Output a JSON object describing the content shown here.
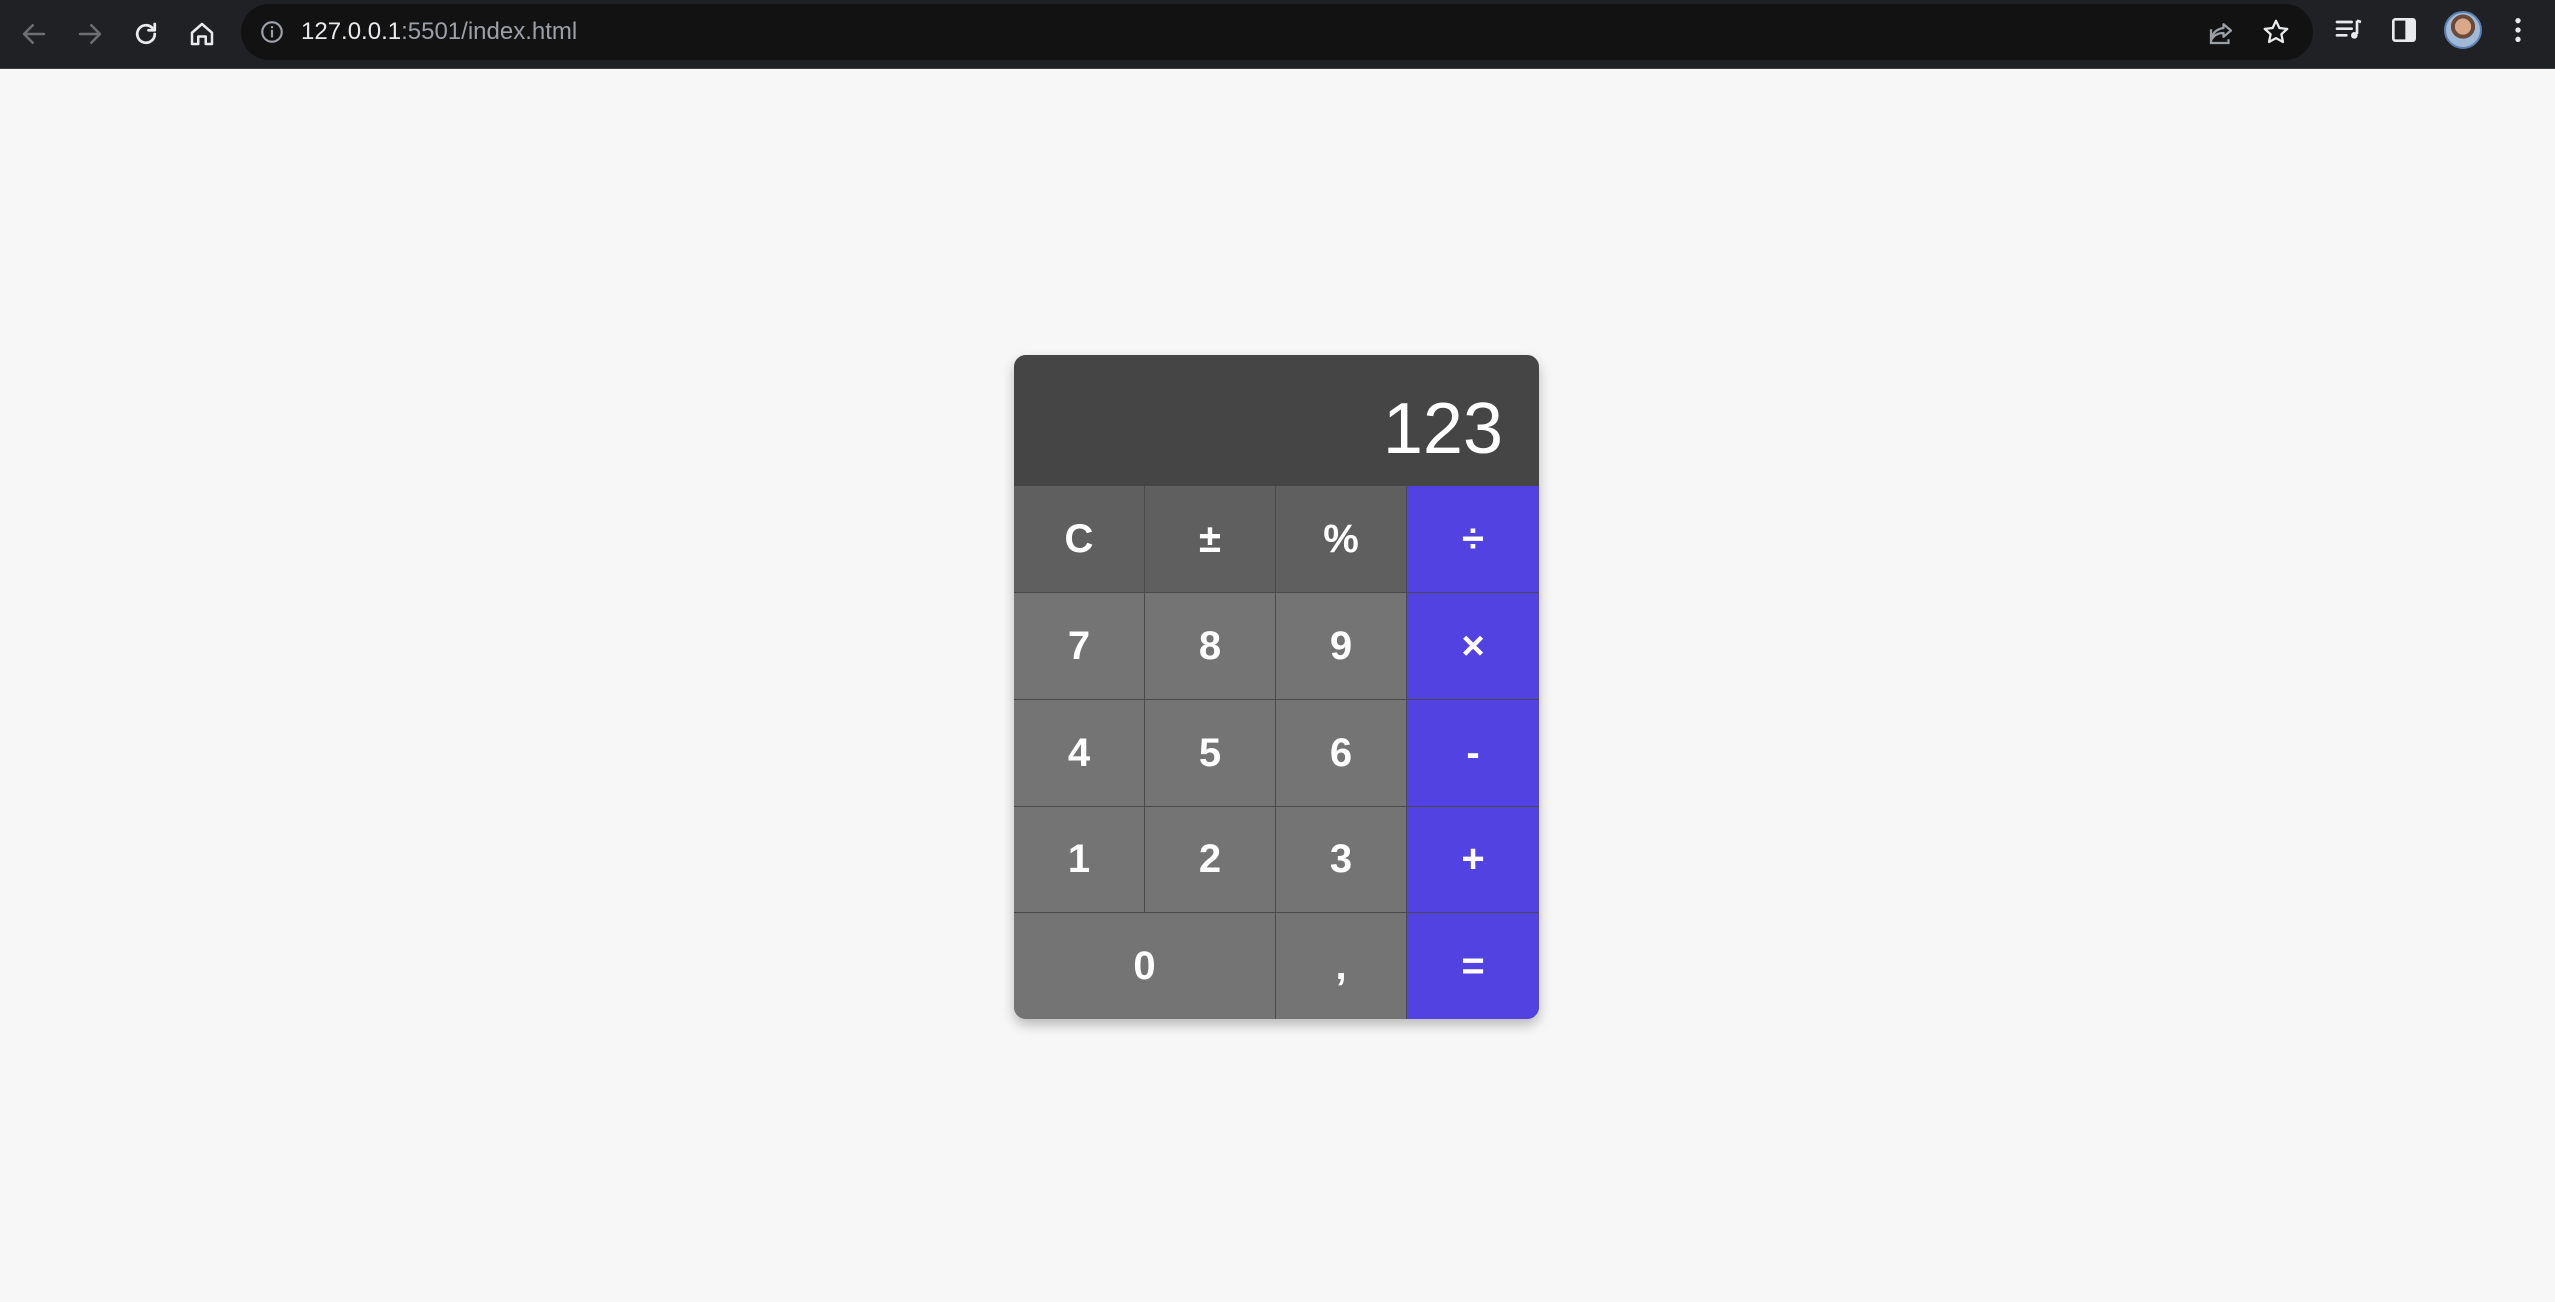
{
  "browser": {
    "url_host": "127.0.0.1",
    "url_rest": ":5501/index.html"
  },
  "icons": {
    "back": "back-arrow-icon",
    "forward": "forward-arrow-icon",
    "reload": "reload-icon",
    "home": "home-icon",
    "site_info": "info-icon",
    "share": "share-icon",
    "bookmark": "star-icon",
    "media": "media-queue-icon",
    "side_panel": "side-panel-icon",
    "menu": "kebab-menu-icon"
  },
  "calculator": {
    "display": "123",
    "colors": {
      "display_bg": "#454545",
      "function_key": "#5f5f5f",
      "number_key": "#747474",
      "operator_key": "#5142e1",
      "page_bg": "#f7f7f7"
    },
    "keys": {
      "clear": "C",
      "sign": "±",
      "percent": "%",
      "divide": "÷",
      "seven": "7",
      "eight": "8",
      "nine": "9",
      "multiply": "×",
      "four": "4",
      "five": "5",
      "six": "6",
      "minus": "-",
      "one": "1",
      "two": "2",
      "three": "3",
      "plus": "+",
      "zero": "0",
      "decimal": ",",
      "equals": "="
    }
  }
}
